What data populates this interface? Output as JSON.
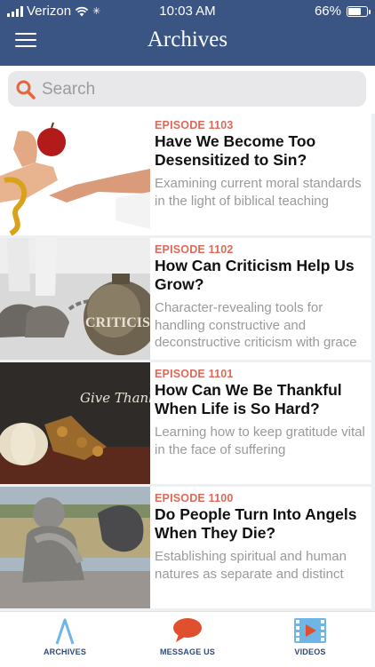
{
  "status_bar": {
    "carrier": "Verizon",
    "time": "10:03 AM",
    "battery": "66%"
  },
  "header": {
    "title": "Archives"
  },
  "search": {
    "placeholder": "Search"
  },
  "episodes": [
    {
      "number": "EPISODE 1103",
      "title": "Have We Become Too Desensitized to Sin?",
      "description": "Examining current moral standards in the light of biblical teaching"
    },
    {
      "number": "EPISODE 1102",
      "title": "How Can Criticism Help Us Grow?",
      "description": "Character-revealing tools for handling constructive and deconstructive criticism with grace",
      "image_text": "CRITICISM"
    },
    {
      "number": "EPISODE 1101",
      "title": "How Can We Be Thankful When Life is So Hard?",
      "description": "Learning how to keep gratitude vital in the face of suffering",
      "image_text": "Give Thanks"
    },
    {
      "number": "EPISODE 1100",
      "title": "Do People Turn Into Angels When They Die?",
      "description": "Establishing spiritual and human natures as separate and distinct"
    }
  ],
  "tabbar": [
    {
      "label": "ARCHIVES",
      "icon": "archives-icon"
    },
    {
      "label": "MESSAGE US",
      "icon": "message-icon"
    },
    {
      "label": "VIDEOS",
      "icon": "videos-icon"
    }
  ],
  "colors": {
    "header": "#3a5583",
    "episode_label": "#dc6a5a",
    "tab_label": "#2e4a7a",
    "accent": "#e8643c"
  }
}
